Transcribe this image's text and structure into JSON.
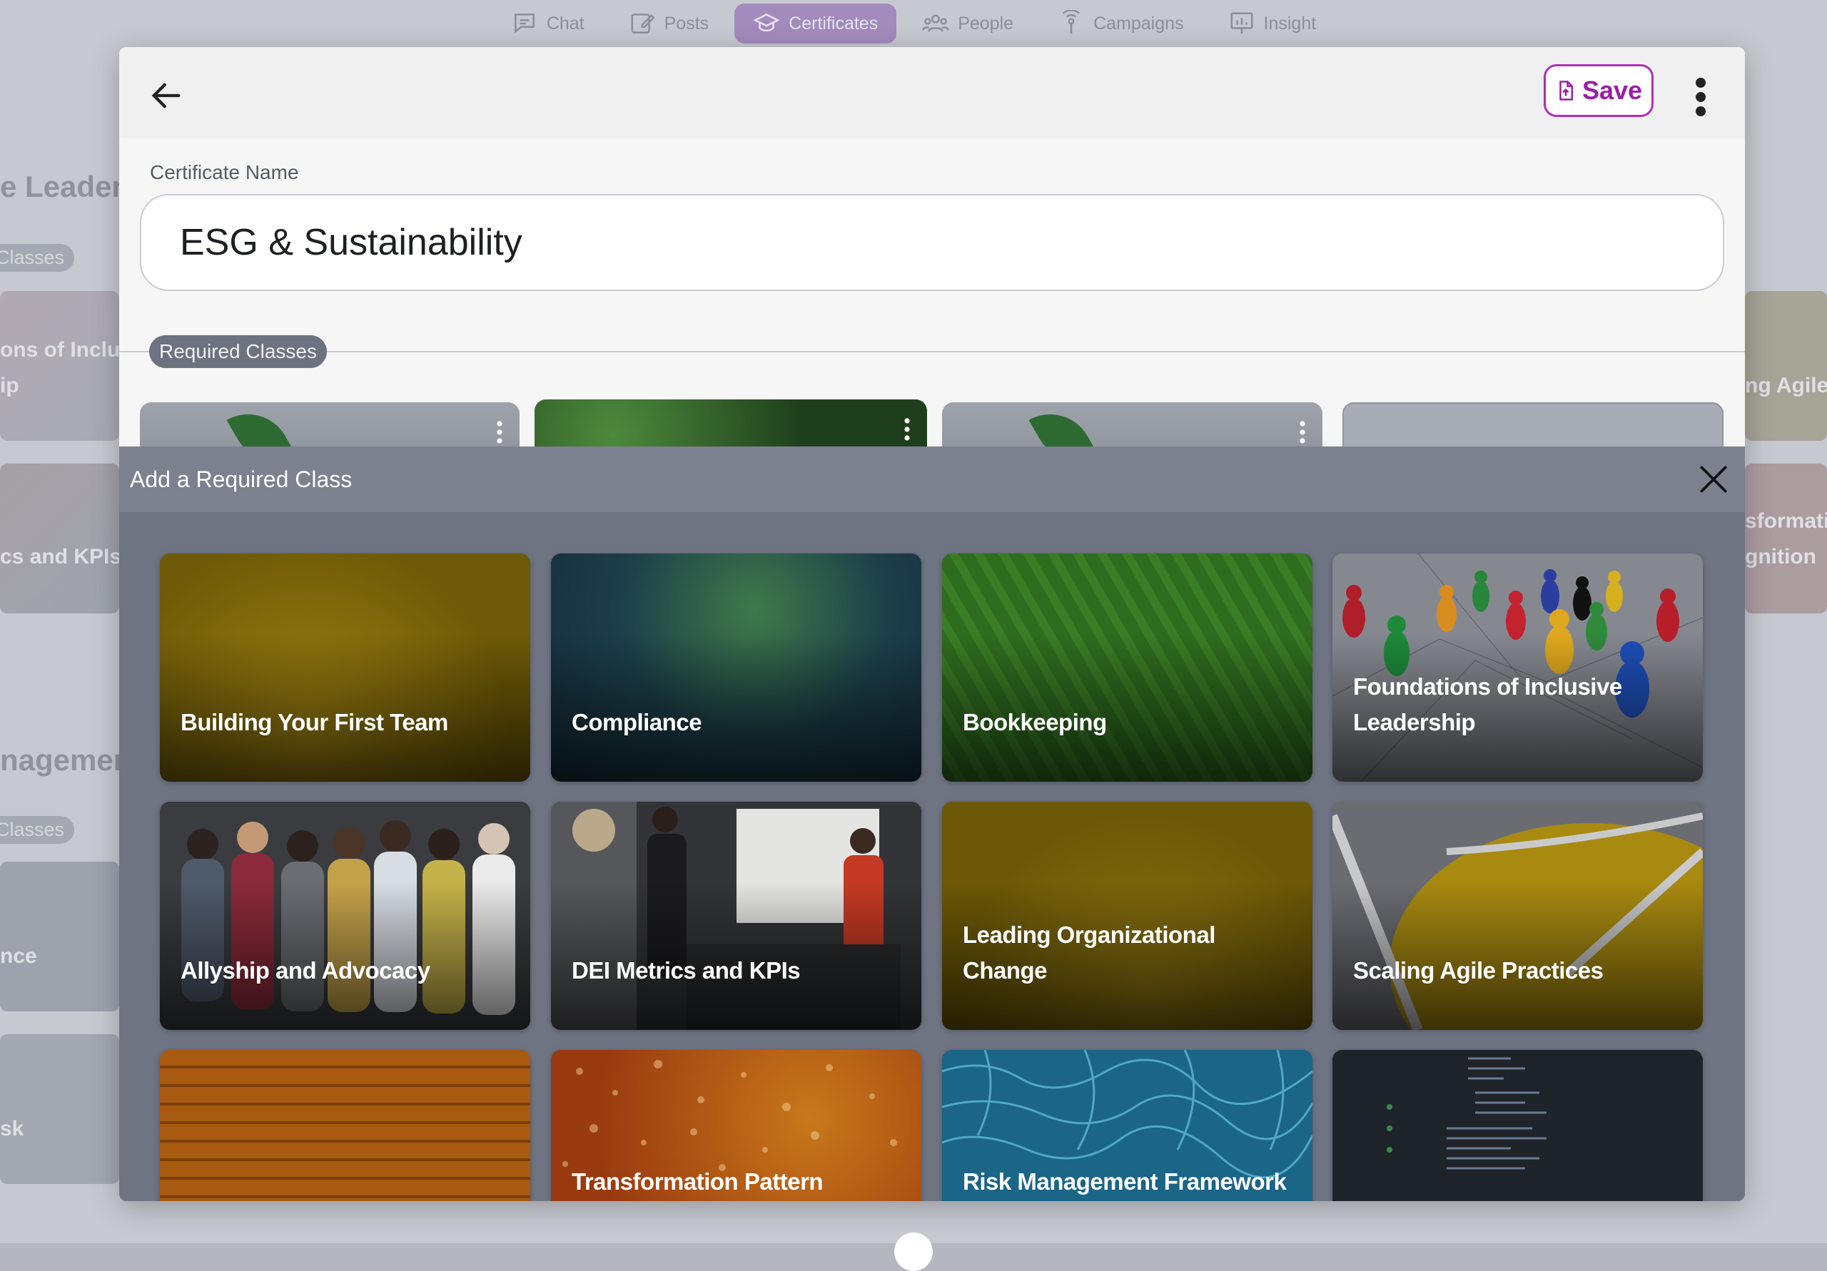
{
  "nav": {
    "tabs": [
      {
        "label": "Chat",
        "icon": "chat-icon"
      },
      {
        "label": "Posts",
        "icon": "edit-icon"
      },
      {
        "label": "Certificates",
        "icon": "graduation-cap-icon",
        "active": true
      },
      {
        "label": "People",
        "icon": "people-icon"
      },
      {
        "label": "Campaigns",
        "icon": "campaign-icon"
      },
      {
        "label": "Insight",
        "icon": "chart-board-icon"
      }
    ]
  },
  "background": {
    "left_texts": [
      "e Leaders",
      "Classes",
      "ons of Inclus",
      "ip",
      "cs and KPIs",
      "nagemen",
      "Classes",
      "nce",
      "sk"
    ],
    "right_texts": [
      "ng Agile",
      "sformati",
      "gnition"
    ]
  },
  "editor": {
    "save_label": "Save",
    "certificate_name_label": "Certificate Name",
    "certificate_name_value": "ESG & Sustainability",
    "required_classes_label": "Required Classes"
  },
  "modal": {
    "title": "Add a Required Class",
    "classes": [
      {
        "title": "Building Your First Team"
      },
      {
        "title": "Compliance"
      },
      {
        "title": "Bookkeeping"
      },
      {
        "title": "Foundations of Inclusive Leadership"
      },
      {
        "title": "Allyship and Advocacy"
      },
      {
        "title": "DEI Metrics and KPIs"
      },
      {
        "title": "Leading Organizational Change"
      },
      {
        "title": "Scaling Agile Practices"
      },
      {
        "title": ""
      },
      {
        "title": "Transformation Pattern"
      },
      {
        "title": "Risk Management Framework"
      },
      {
        "title": ""
      }
    ]
  },
  "colors": {
    "accent": "#9a1fa6",
    "active_tab": "#a38bbd",
    "modal_bg": "#6f7483"
  }
}
